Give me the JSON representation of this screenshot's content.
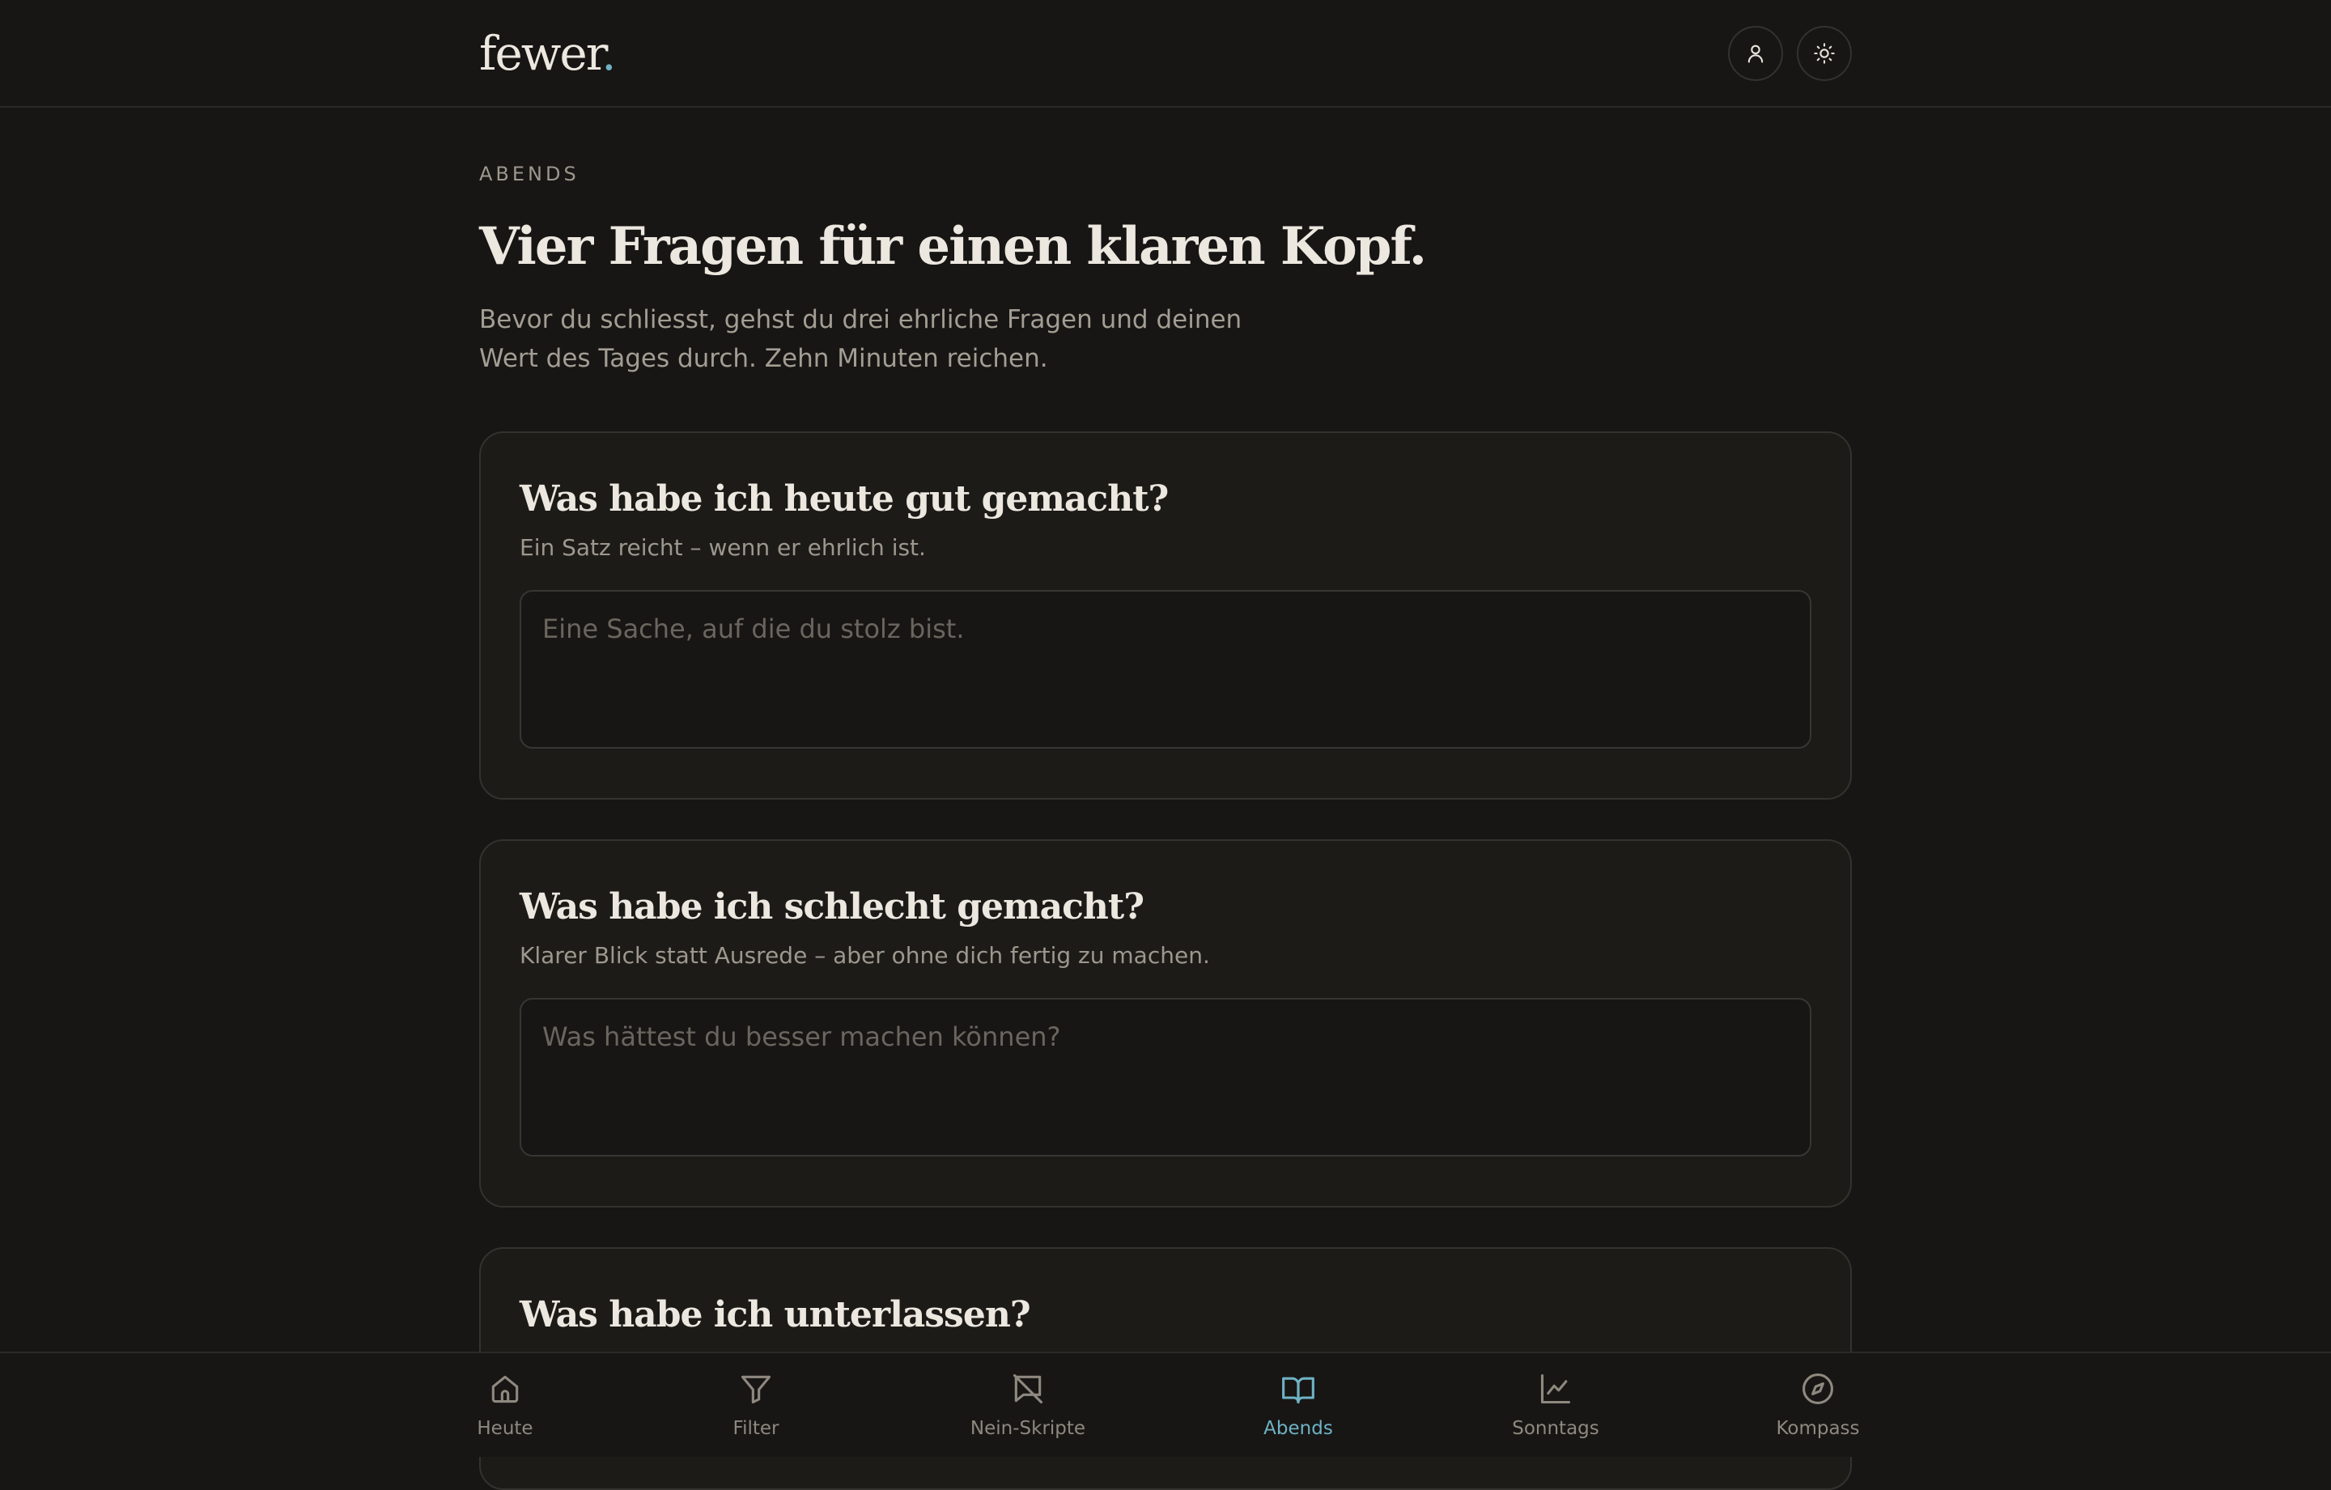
{
  "app": {
    "logo_text": "fewer",
    "logo_dot": ".",
    "accent_color": "#6fb2c4"
  },
  "header": {
    "account_icon": "user-icon",
    "theme_icon": "sun-icon"
  },
  "page": {
    "eyebrow": "ABENDS",
    "title": "Vier Fragen für einen klaren Kopf.",
    "intro": "Bevor du schliesst, gehst du drei ehrliche Fragen und deinen Wert des Tages durch. Zehn Minuten reichen."
  },
  "questions": [
    {
      "title": "Was habe ich heute gut gemacht?",
      "hint": "Ein Satz reicht – wenn er ehrlich ist.",
      "placeholder": "Eine Sache, auf die du stolz bist.",
      "value": ""
    },
    {
      "title": "Was habe ich schlecht gemacht?",
      "hint": "Klarer Blick statt Ausrede – aber ohne dich fertig zu machen.",
      "placeholder": "Was hättest du besser machen können?",
      "value": ""
    },
    {
      "title": "Was habe ich unterlassen?"
    }
  ],
  "nav": {
    "items": [
      {
        "label": "Heute",
        "icon": "home-icon"
      },
      {
        "label": "Filter",
        "icon": "filter-icon"
      },
      {
        "label": "Nein-Skripte",
        "icon": "message-off-icon"
      },
      {
        "label": "Abends",
        "icon": "book-open-icon",
        "active": true
      },
      {
        "label": "Sonntags",
        "icon": "chart-line-icon"
      },
      {
        "label": "Kompass",
        "icon": "compass-icon"
      }
    ]
  }
}
